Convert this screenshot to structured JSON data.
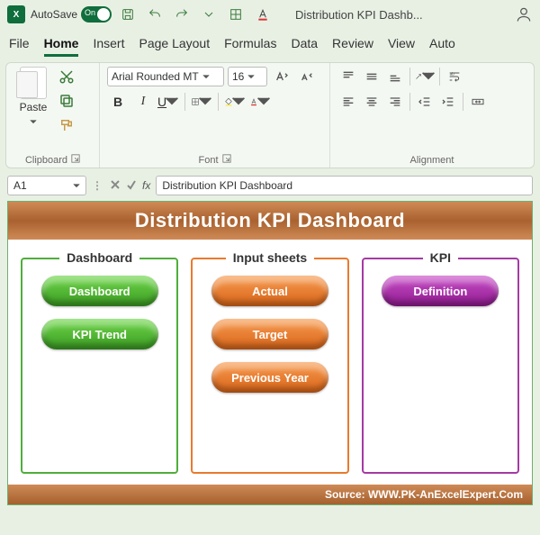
{
  "titlebar": {
    "app_glyph": "X",
    "autosave_label": "AutoSave",
    "autosave_state": "On",
    "doc_title": "Distribution KPI Dashb..."
  },
  "tabs": [
    "File",
    "Home",
    "Insert",
    "Page Layout",
    "Formulas",
    "Data",
    "Review",
    "View",
    "Auto"
  ],
  "active_tab_index": 1,
  "ribbon": {
    "clipboard": {
      "label": "Clipboard",
      "paste_label": "Paste"
    },
    "font": {
      "label": "Font",
      "family": "Arial Rounded MT",
      "size": "16",
      "bold": "B",
      "italic": "I",
      "underline": "U"
    },
    "alignment": {
      "label": "Alignment"
    }
  },
  "formula_bar": {
    "name_box": "A1",
    "fx_label": "fx",
    "content": "Distribution KPI Dashboard"
  },
  "sheet": {
    "banner": "Distribution KPI Dashboard",
    "groups": [
      {
        "title": "Dashboard",
        "color": "green",
        "buttons": [
          "Dashboard",
          "KPI Trend"
        ]
      },
      {
        "title": "Input sheets",
        "color": "orange",
        "buttons": [
          "Actual",
          "Target",
          "Previous Year"
        ]
      },
      {
        "title": "KPI",
        "color": "purple",
        "buttons": [
          "Definition"
        ]
      }
    ],
    "footer": "Source: WWW.PK-AnExcelExpert.Com"
  }
}
